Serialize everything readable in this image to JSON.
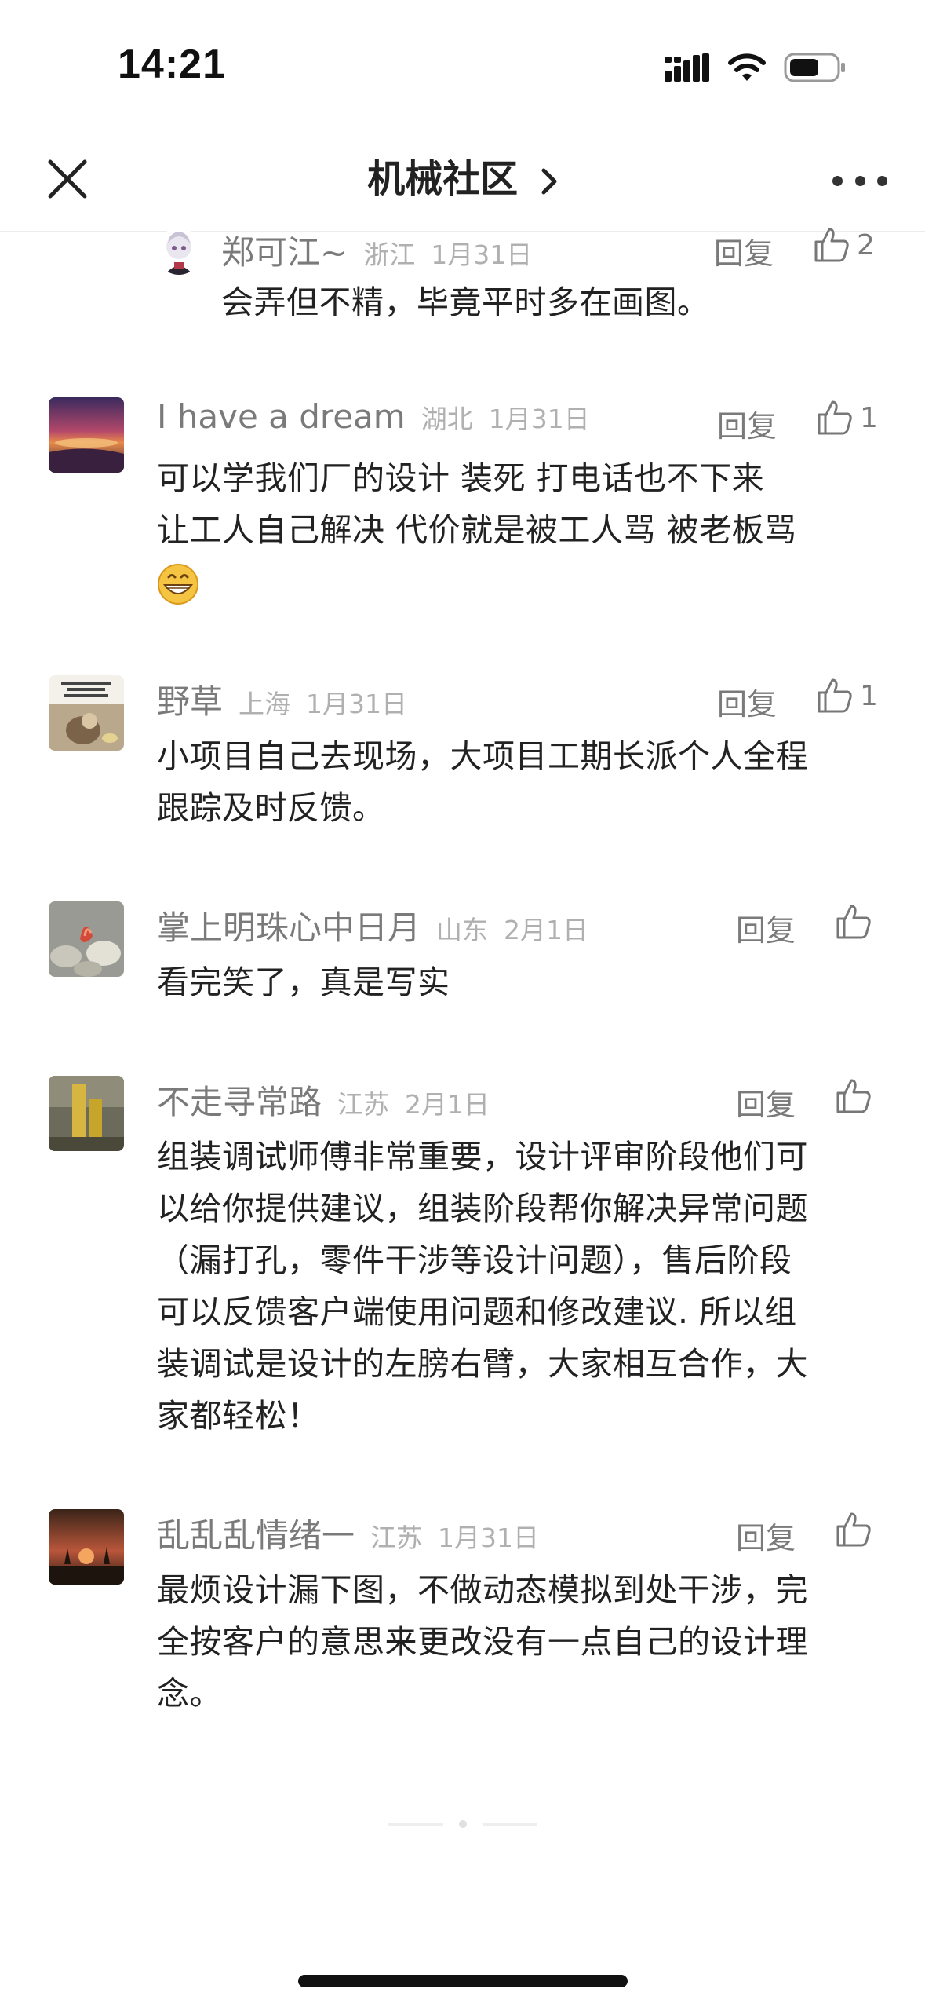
{
  "status_bar": {
    "time": "14:21"
  },
  "nav": {
    "title": "机械社区",
    "close_icon": "close-icon",
    "more_icon": "more-icon"
  },
  "reply_label": "回复",
  "comments": [
    {
      "author": "郑可江~",
      "region": "浙江",
      "date": "1月31日",
      "likes": "2",
      "text": "会弄但不精，毕竟平时多在画图。"
    },
    {
      "author": "I have a dream",
      "region": "湖北",
      "date": "1月31日",
      "likes": "1",
      "text_lines": [
        "可以学我们厂的设计  装死  打电话也不下来",
        "让工人自己解决 代价就是被工人骂 被老板骂"
      ],
      "emoji": "grinning-emoji"
    },
    {
      "author": "野草",
      "region": "上海",
      "date": "1月31日",
      "likes": "1",
      "text_lines": [
        "小项目自己去现场，大项目工期长派个人全程",
        "跟踪及时反馈。"
      ]
    },
    {
      "author": "掌上明珠心中日月",
      "region": "山东",
      "date": "2月1日",
      "likes": "",
      "text": "看完笑了，真是写实"
    },
    {
      "author": "不走寻常路",
      "region": "江苏",
      "date": "2月1日",
      "likes": "",
      "text_lines": [
        "组装调试师傅非常重要，设计评审阶段他们可",
        "以给你提供建议，组装阶段帮你解决异常问题",
        "（漏打孔，零件干涉等设计问题），售后阶段",
        "可以反馈客户端使用问题和修改建议. 所以组",
        "装调试是设计的左膀右臂，大家相互合作，大",
        "家都轻松！"
      ]
    },
    {
      "author": "乱乱乱情绪一",
      "region": "江苏",
      "date": "1月31日",
      "likes": "",
      "text_lines": [
        "最烦设计漏下图，不做动态模拟到处干涉，完",
        "全按客户的意思来更改没有一点自己的设计理",
        "念。"
      ]
    }
  ]
}
